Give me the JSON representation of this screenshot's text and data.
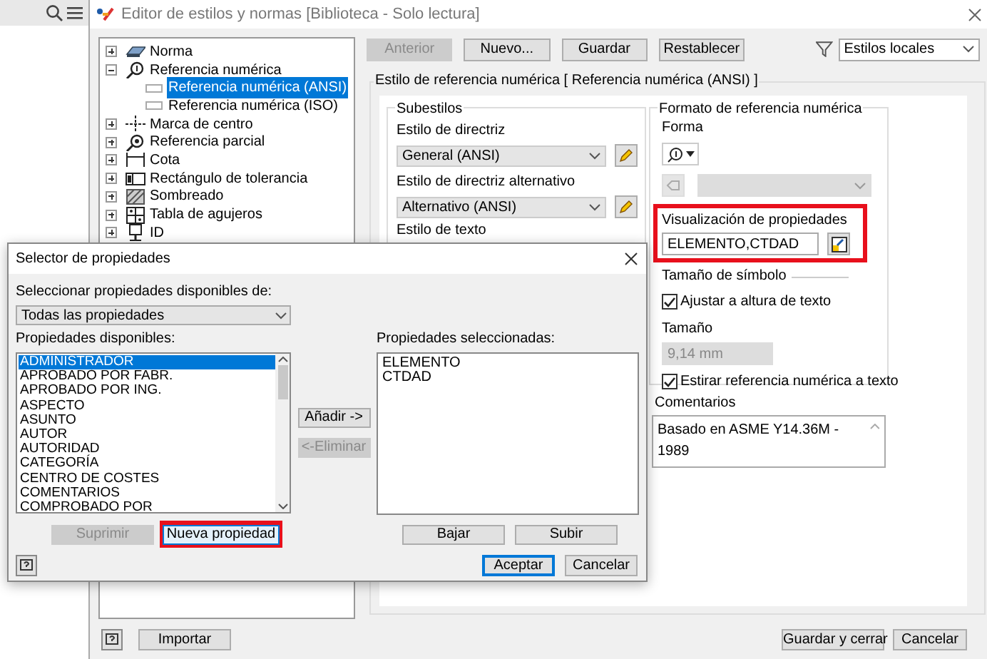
{
  "main_window": {
    "title": "Editor de estilos y normas [Biblioteca - Solo lectura]",
    "tree": [
      {
        "label": "Norma",
        "expanded": false,
        "selected": false
      },
      {
        "label": "Referencia numérica",
        "expanded": true,
        "selected": false,
        "children": [
          {
            "label": "Referencia numérica (ANSI)",
            "selected": true
          },
          {
            "label": "Referencia numérica (ISO)",
            "selected": false
          }
        ]
      },
      {
        "label": "Marca de centro",
        "expanded": false,
        "selected": false
      },
      {
        "label": "Referencia parcial",
        "expanded": false,
        "selected": false
      },
      {
        "label": "Cota",
        "expanded": false,
        "selected": false
      },
      {
        "label": "Rectángulo de tolerancia",
        "expanded": false,
        "selected": false
      },
      {
        "label": "Sombreado",
        "expanded": false,
        "selected": false
      },
      {
        "label": "Tabla de agujeros",
        "expanded": false,
        "selected": false
      },
      {
        "label": "ID",
        "expanded": false,
        "selected": false
      }
    ],
    "toolbar": {
      "buttons": [
        {
          "label": "Anterior",
          "disabled": true
        },
        {
          "label": "Nuevo...",
          "disabled": false
        },
        {
          "label": "Guardar",
          "disabled": false
        },
        {
          "label": "Restablecer",
          "disabled": false
        }
      ],
      "filter": "Estilos locales"
    },
    "style_heading": "Estilo de referencia numérica [ Referencia numérica (ANSI) ]",
    "substyles": {
      "title": "Subestilos",
      "leader_label": "Estilo de directriz",
      "leader_value": "General (ANSI)",
      "alt_leader_label": "Estilo de directriz alternativo",
      "alt_leader_value": "Alternativo (ANSI)",
      "text_label": "Estilo de texto"
    },
    "format": {
      "title": "Formato de referencia numérica",
      "shape_label": "Forma",
      "property_label": "Visualización de propiedades",
      "property_value": "ELEMENTO,CTDAD",
      "property_highlighted": true,
      "size_title": "Tamaño de símbolo",
      "fit": {
        "label": "Ajustar a altura de texto",
        "checked": true
      },
      "size_label": "Tamaño",
      "size_value": "9,14 mm",
      "size_disabled": true,
      "stretch": {
        "label": "Estirar referencia numérica a texto",
        "checked": true
      }
    },
    "comments": {
      "label": "Comentarios",
      "value": "Basado en ASME Y14.36M - 1989"
    },
    "footer": {
      "import": "Importar",
      "save_close": "Guardar y cerrar",
      "cancel": "Cancelar"
    }
  },
  "dialog": {
    "title": "Selector de propiedades",
    "source_label": "Seleccionar propiedades disponibles de:",
    "source_value": "Todas las propiedades",
    "available_label": "Propiedades disponibles:",
    "available": [
      {
        "label": "ADMINISTRADOR",
        "selected": true
      },
      {
        "label": "APROBADO POR FABR.",
        "selected": false
      },
      {
        "label": "APROBADO POR ING.",
        "selected": false
      },
      {
        "label": "ASPECTO",
        "selected": false
      },
      {
        "label": "ASUNTO",
        "selected": false
      },
      {
        "label": "AUTOR",
        "selected": false
      },
      {
        "label": "AUTORIDAD",
        "selected": false
      },
      {
        "label": "CATEGORÍA",
        "selected": false
      },
      {
        "label": "CENTRO DE COSTES",
        "selected": false
      },
      {
        "label": "COMENTARIOS",
        "selected": false
      },
      {
        "label": "COMPROBADO POR",
        "selected": false
      }
    ],
    "add": {
      "label": "Añadir ->",
      "disabled": false
    },
    "remove": {
      "label": "<-Eliminar",
      "disabled": true
    },
    "selected_label": "Propiedades seleccionadas:",
    "selected_items": [
      "ELEMENTO",
      "CTDAD"
    ],
    "delete": {
      "label": "Suprimir",
      "disabled": true
    },
    "new_property": {
      "label": "Nueva propiedad",
      "highlighted": true
    },
    "down": "Bajar",
    "up": "Subir",
    "ok": "Aceptar",
    "cancel": "Cancelar"
  }
}
